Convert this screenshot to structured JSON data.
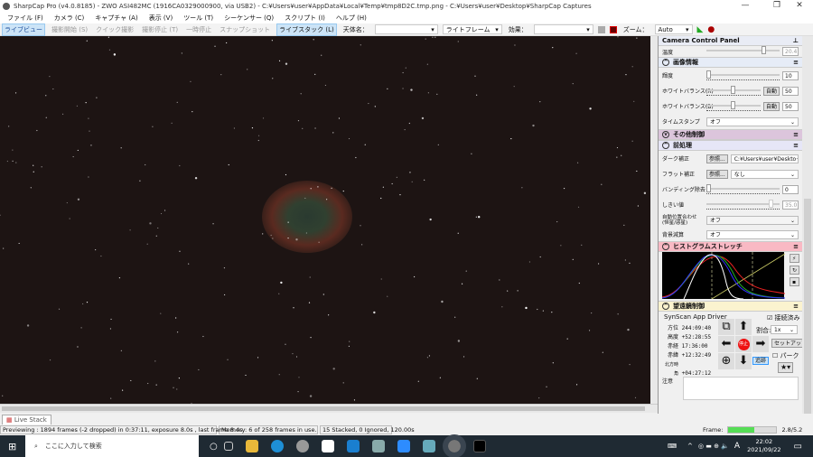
{
  "titlebar": {
    "title": "SharpCap Pro (v4.0.8185) - ZWO ASI482MC (1916CA0329000900, via USB2) - C:¥Users¥user¥AppData¥Local¥Temp¥tmp8D2C.tmp.png - C:¥Users¥user¥Desktop¥SharpCap Captures",
    "minimize": "—",
    "maximize": "❐",
    "close": "✕"
  },
  "menu": [
    "ファイル (F)",
    "カメラ (C)",
    "キャプチャ (A)",
    "表示 (V)",
    "ツール (T)",
    "シーケンサー (Q)",
    "スクリプト (I)",
    "ヘルプ (H)"
  ],
  "toolbar": {
    "live_view": "ライブビュー",
    "start_capture": "撮影開始 (S)",
    "quick_capture": "クイック撮影",
    "stop_capture": "撮影停止 (T)",
    "pause": "一時停止",
    "snapshot": "スナップショット",
    "live_stack": "ライブスタック (L)",
    "target_label": "天体名：",
    "target_value": "",
    "frame_type": "ライトフレーム",
    "effect_label": "効果：",
    "effect_value": "",
    "zoom_label": "ズーム：",
    "zoom_value": "Auto"
  },
  "panel": {
    "title": "Camera Control Panel",
    "temp_label": "温度",
    "temp_value": "20.4",
    "image_section": {
      "title": "画像情報",
      "gamma_label": "輝度",
      "gamma_value": "10",
      "wb_r_label": "ホワイトバランス(R)",
      "wb_r_auto": "自動",
      "wb_r_value": "50",
      "wb_b_label": "ホワイトバランス(B)",
      "wb_b_auto": "自動",
      "wb_b_value": "50",
      "timestamp_label": "タイムスタンプ",
      "timestamp_value": "オフ"
    },
    "other_section": {
      "title": "その他制御"
    },
    "preprocess": {
      "title": "前処理",
      "dark_label": "ダーク補正",
      "dark_browse": "参照...",
      "dark_value": "C:¥Users¥user¥Deskto···",
      "flat_label": "フラット補正",
      "flat_browse": "参照...",
      "flat_value": "なし",
      "banding_label": "バンディング除去",
      "banding_value": "0",
      "threshold_label": "しきい値",
      "threshold_value": "35.0",
      "align_label": "自動位置合わせ (恒星/惑星)",
      "align_value": "オフ",
      "bg_label": "背景減算",
      "bg_value": "オフ"
    },
    "histogram": {
      "title": "ヒストグラムストレッチ"
    },
    "mount": {
      "title": "望遠鏡制御",
      "driver": "SynScan App Driver",
      "connected_label": "接続済み",
      "connected": true,
      "rate_label": "割合:",
      "rate_value": "1x",
      "setup": "セットアップ",
      "park": "パーク",
      "stop": "停止",
      "track": "追跡",
      "readouts": [
        {
          "label": "方位",
          "value": "244:09:40"
        },
        {
          "label": "高度",
          "value": "+52:28:55"
        },
        {
          "label": "赤経",
          "value": "17:36:00"
        },
        {
          "label": "赤緯",
          "value": "+12:32:49"
        },
        {
          "label": "北方時角",
          "value": "+04:27:12"
        }
      ]
    },
    "notes_label": "注意"
  },
  "tabs": {
    "live_stack": "Live Stack"
  },
  "status": {
    "preview": "Previewing : 1894 frames (-2 dropped) in 0:37:11, exposure 8.0s , last frame 8.4s",
    "memory": "Memory: 6 of 258 frames in use.",
    "stacked": "15 Stacked, 0 Ignored, 120.00s",
    "frame_label": "Frame:",
    "frame_value": "2.8/5.2",
    "frame_progress": 0.54
  },
  "taskbar": {
    "search_placeholder": "ここに入力して検索",
    "time": "22:02",
    "date": "2021/09/22",
    "ime": "A"
  }
}
